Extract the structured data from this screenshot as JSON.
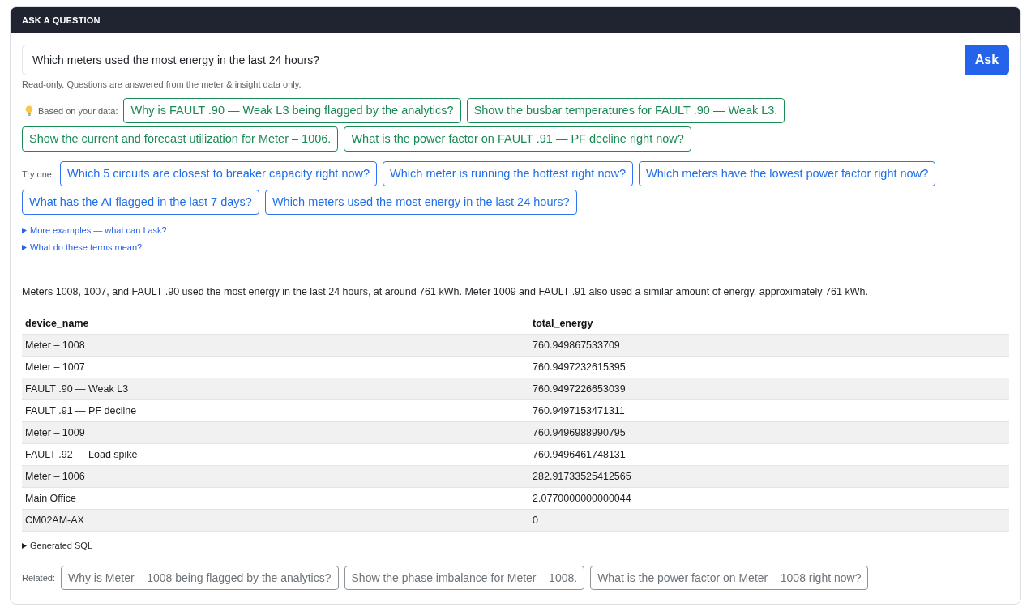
{
  "panel": {
    "title": "ASK A QUESTION"
  },
  "question": {
    "value": "Which meters used the most energy in the last 24 hours?",
    "button": "Ask",
    "note": "Read-only. Questions are answered from the meter & insight data only."
  },
  "suggestions": {
    "label": "Based on your data:",
    "chips": [
      "Why is FAULT .90 — Weak L3 being flagged by the analytics?",
      "Show the busbar temperatures for FAULT .90 — Weak L3.",
      "Show the current and forecast utilization for Meter – 1006.",
      "What is the power factor on FAULT .91 — PF decline right now?"
    ]
  },
  "examples": {
    "label": "Try one:",
    "chips": [
      "Which 5 circuits are closest to breaker capacity right now?",
      "Which meter is running the hottest right now?",
      "Which meters have the lowest power factor right now?",
      "What has the AI flagged in the last 7 days?",
      "Which meters used the most energy in the last 24 hours?"
    ]
  },
  "disclosures": [
    {
      "label": "More examples — what can I ask?",
      "expanded": false
    },
    {
      "label": "What do these terms mean?",
      "expanded": false
    }
  ],
  "answer": {
    "text": "Meters 1008, 1007, and FAULT .90 used the most energy in the last 24 hours, at around 761 kWh. Meter 1009 and FAULT .91 also used a similar amount of energy, approximately 761 kWh.",
    "table": {
      "columns": [
        "device_name",
        "total_energy"
      ],
      "rows": [
        [
          "Meter – 1008",
          "760.949867533709"
        ],
        [
          "Meter – 1007",
          "760.9497232615395"
        ],
        [
          "FAULT .90 — Weak L3",
          "760.9497226653039"
        ],
        [
          "FAULT .91 — PF decline",
          "760.9497153471311"
        ],
        [
          "Meter – 1009",
          "760.9496988990795"
        ],
        [
          "FAULT .92 — Load spike",
          "760.9496461748131"
        ],
        [
          "Meter – 1006",
          "282.91733525412565"
        ],
        [
          "Main Office",
          "2.0770000000000044"
        ],
        [
          "CM02AM-AX",
          "0"
        ]
      ]
    },
    "sql": {
      "label": "Generated SQL",
      "expanded": false
    }
  },
  "related": {
    "label": "Related:",
    "chips": [
      "Why is Meter – 1008 being flagged by the analytics?",
      "Show the phase imbalance for Meter – 1008.",
      "What is the power factor on Meter – 1008 right now?"
    ]
  }
}
